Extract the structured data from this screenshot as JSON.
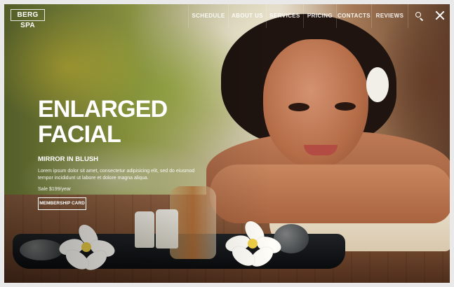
{
  "brand": {
    "logo_text": "BERG SPA"
  },
  "nav": {
    "items": [
      {
        "label": "SCHEDULE"
      },
      {
        "label": "ABOUT US"
      },
      {
        "label": "SERVICES"
      },
      {
        "label": "PRICING"
      },
      {
        "label": "CONTACTS"
      },
      {
        "label": "REVIEWS"
      }
    ],
    "search_icon": "search-icon",
    "close_icon": "close-icon"
  },
  "hero": {
    "title_line1": "ENLARGED",
    "title_line2": "FACIAL",
    "subtitle": "MIRROR IN BLUSH",
    "description": "Lorem ipsum dolor sit amet, consectetur adipisicing elit, sed do eiusmod tempor incididunt ut labore et dolore magna aliqua.",
    "price": "Sale $199/year",
    "cta": "MEMBERSHIP CARD"
  },
  "colors": {
    "text": "#ffffff",
    "accent_yellow": "#e6cf3e",
    "wood": "#7c4f33",
    "skin": "#b56d48"
  }
}
